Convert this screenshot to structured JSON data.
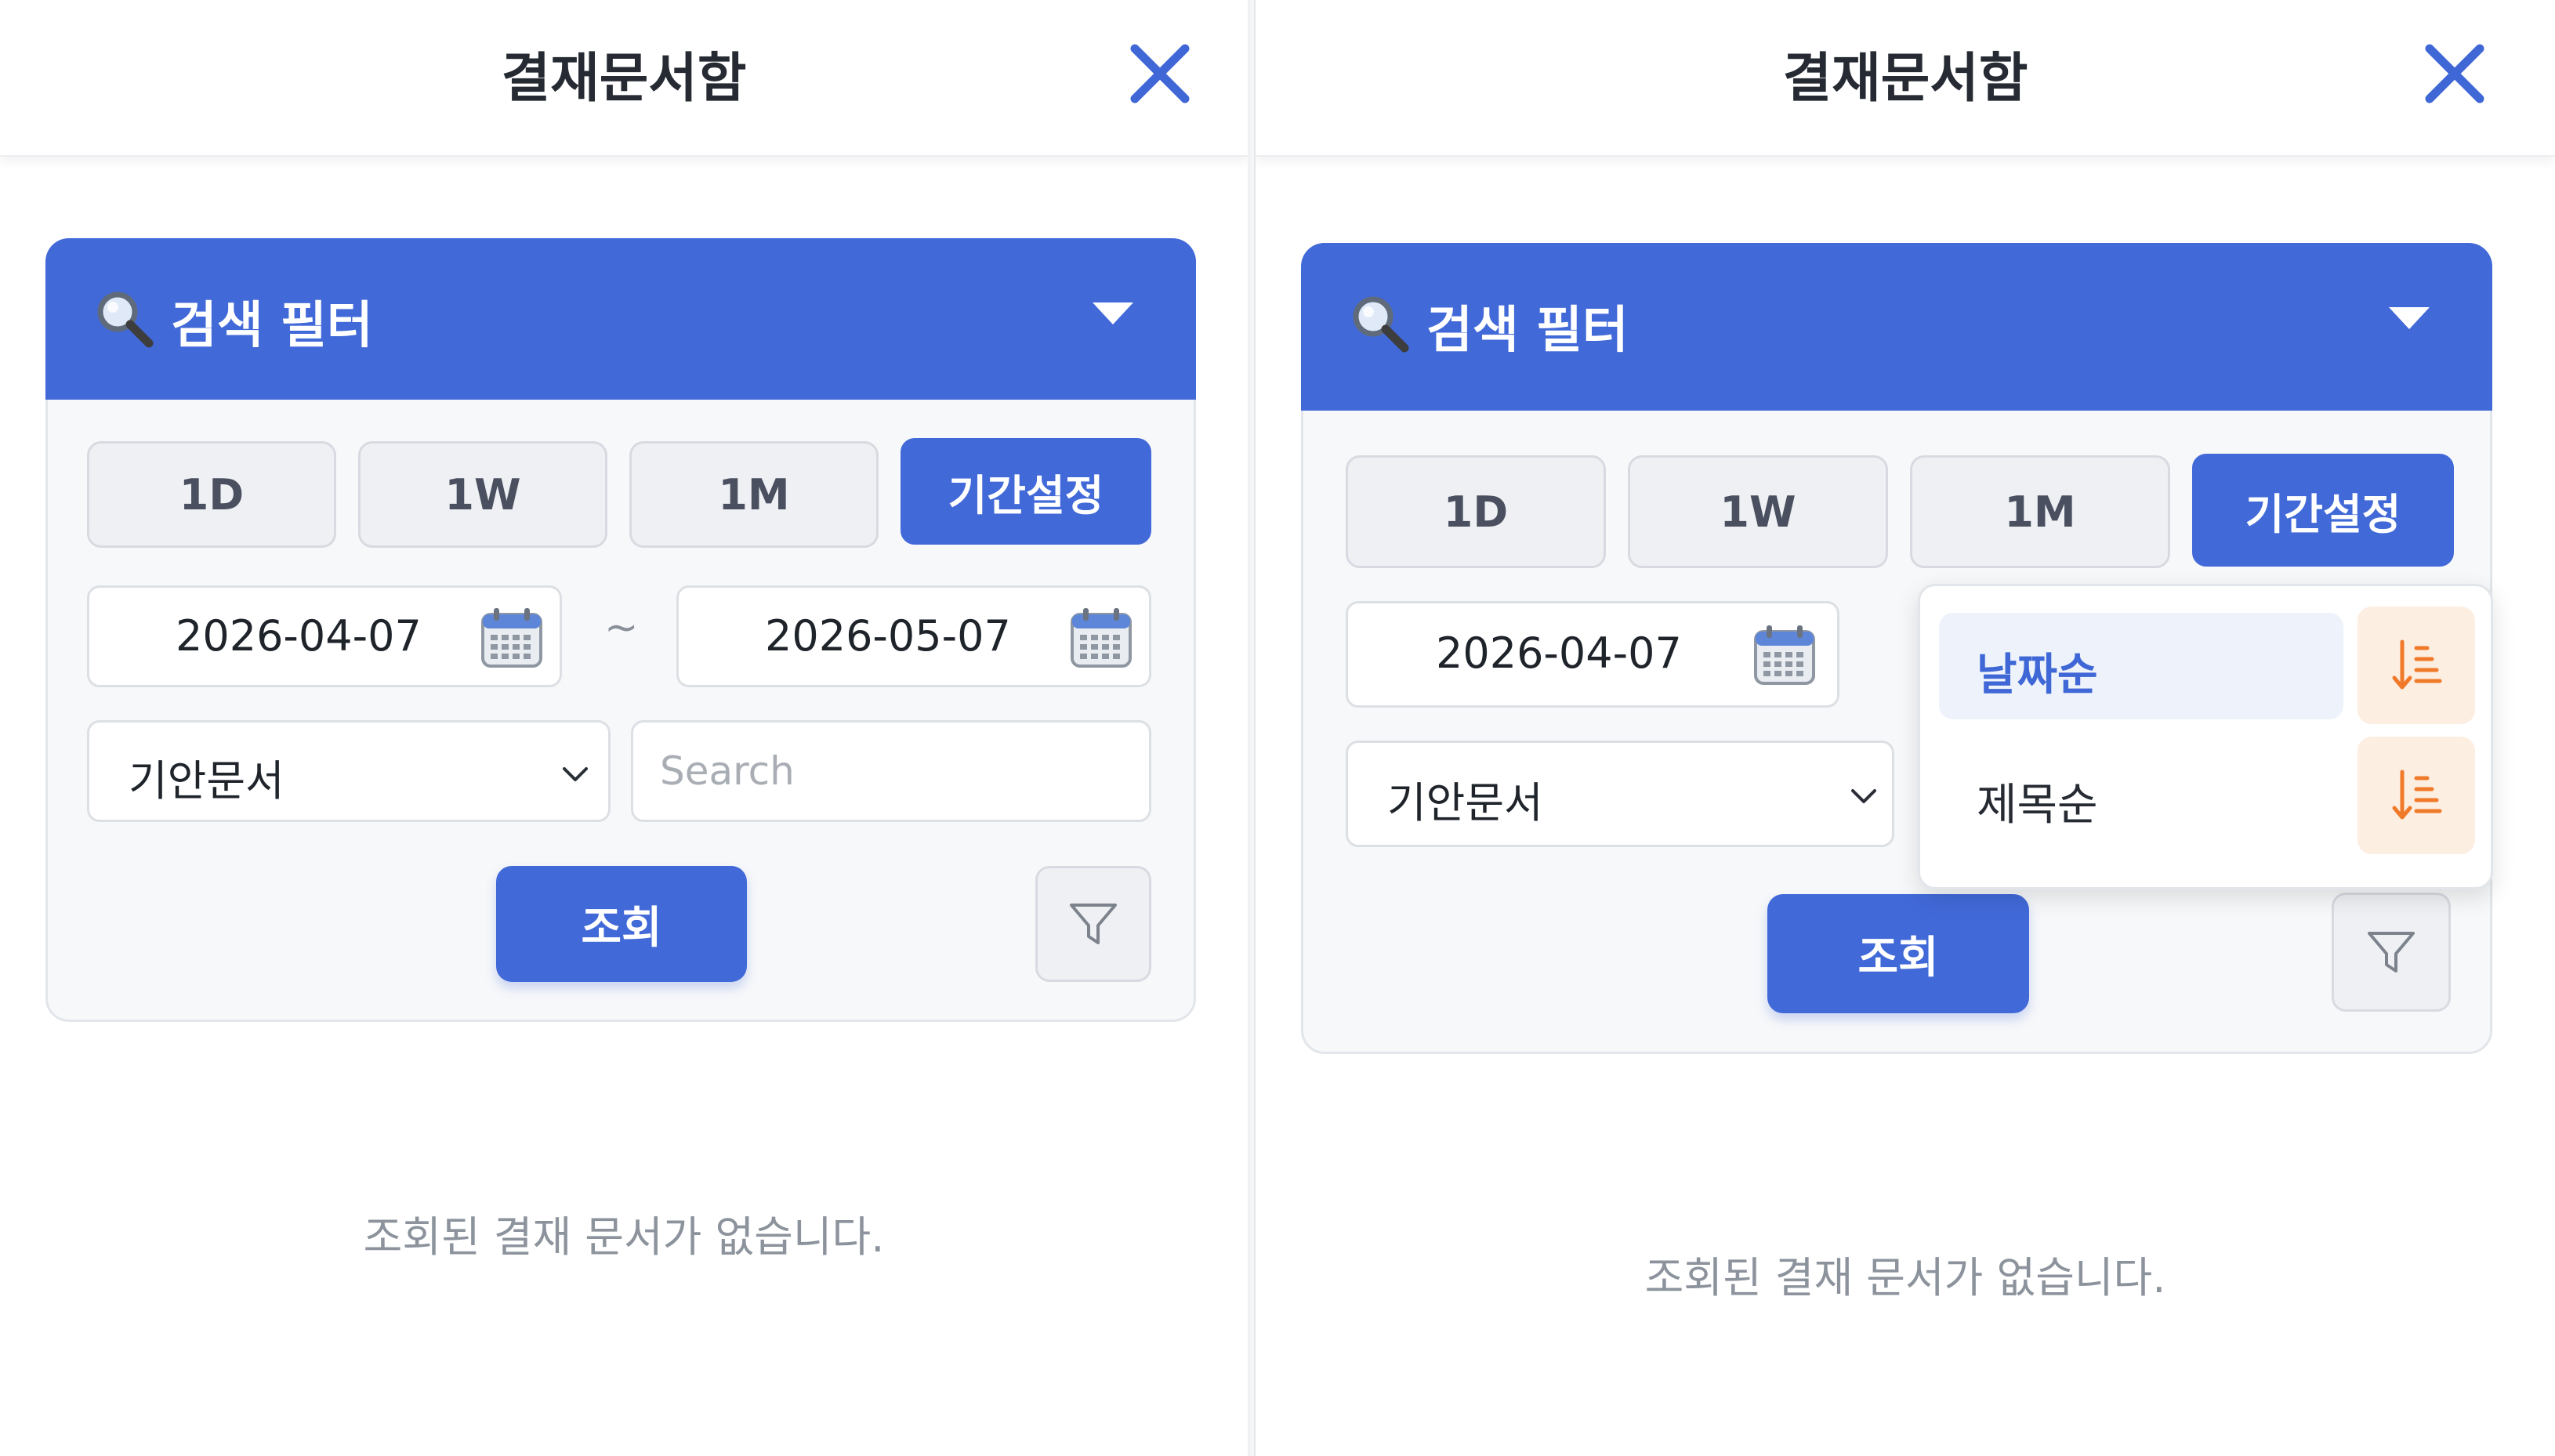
{
  "left": {
    "title": "결재문서함",
    "filter_title": "검색 필터",
    "periods": [
      {
        "label": "1D",
        "active": false
      },
      {
        "label": "1W",
        "active": false
      },
      {
        "label": "1M",
        "active": false
      },
      {
        "label": "기간설정",
        "active": true
      }
    ],
    "start_date": "2026-04-07",
    "range_separator": "~",
    "end_date": "2026-05-07",
    "doc_type_selected": "기안문서",
    "search_placeholder": "Search",
    "query_label": "조회",
    "empty_message": "조회된 결재 문서가 없습니다."
  },
  "right": {
    "title": "결재문서함",
    "filter_title": "검색 필터",
    "periods": [
      {
        "label": "1D",
        "active": false
      },
      {
        "label": "1W",
        "active": false
      },
      {
        "label": "1M",
        "active": false
      },
      {
        "label": "기간설정",
        "active": true
      }
    ],
    "start_date": "2026-04-07",
    "doc_type_selected": "기안문서",
    "sort_menu": {
      "items": [
        {
          "label": "날짜순",
          "selected": true
        },
        {
          "label": "제목순",
          "selected": false
        }
      ]
    },
    "query_label": "조회",
    "empty_message": "조회된 결재 문서가 없습니다."
  },
  "colors": {
    "primary": "#4169d8",
    "sort_accent": "#f07a2a",
    "sort_bg": "#fdeee2",
    "muted_text": "#8c939c"
  }
}
